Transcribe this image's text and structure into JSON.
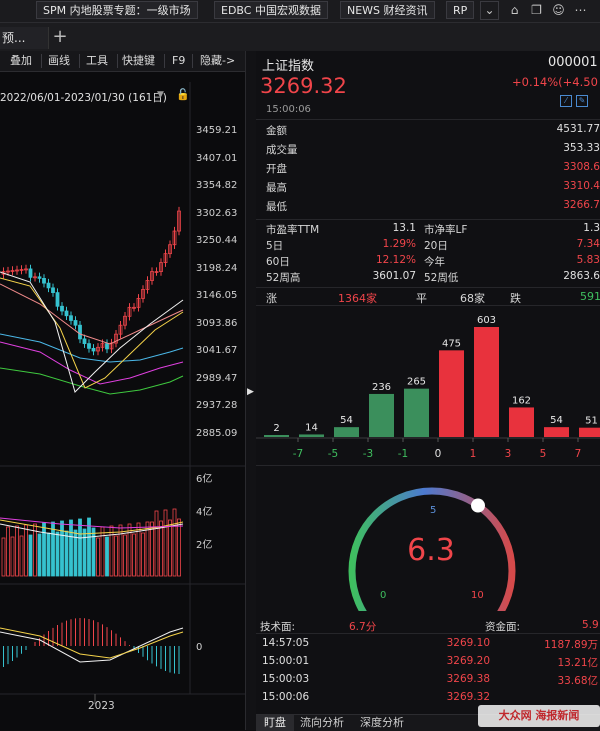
{
  "topbar": {
    "buttons": [
      "SPM 内地股票专题：一级市场",
      "EDBC 中国宏观数据",
      "NEWS 财经资讯",
      "RP"
    ]
  },
  "tabbar": {
    "tab_label": "预...",
    "add_label": "+"
  },
  "toolbar": {
    "items": [
      "叠加",
      "画线",
      "工具",
      "快捷键",
      "F9",
      "隐藏->"
    ]
  },
  "chart": {
    "date_range": "2022/06/01-2023/01/30 (161日)",
    "price_ticks": [
      "3459.21",
      "3407.01",
      "3354.82",
      "3302.63",
      "3250.44",
      "3198.24",
      "3146.05",
      "3093.86",
      "3041.67",
      "2989.47",
      "2937.28",
      "2885.09"
    ],
    "volume_ticks": [
      "6亿",
      "4亿",
      "2亿"
    ],
    "macd_tick": "0",
    "x_label": "2023",
    "colors": {
      "up": "#f0454a",
      "down": "#36c2cf",
      "ma1": "#f2f2f2",
      "ma2": "#f5d34a",
      "ma3": "#e040e0",
      "ma4": "#3fc93f",
      "ma5": "#4bb8e8",
      "ma6": "#f08a8a"
    }
  },
  "quote": {
    "name": "上证指数",
    "code": "000001",
    "price": "3269.32",
    "change": "+0.14%(+4.50",
    "time": "15:00:06"
  },
  "stats": [
    {
      "label": "金额",
      "value": "4531.77",
      "color": "neutral"
    },
    {
      "label": "成交量",
      "value": "353.33",
      "color": "neutral"
    },
    {
      "label": "开盘",
      "value": "3308.6",
      "color": "red"
    },
    {
      "label": "最高",
      "value": "3310.4",
      "color": "red"
    },
    {
      "label": "最低",
      "value": "3266.7",
      "color": "red"
    }
  ],
  "valuation": [
    {
      "l1": "市盈率TTM",
      "v1": "13.1",
      "c1": "neutral",
      "l2": "市净率LF",
      "v2": "1.3",
      "c2": "neutral"
    },
    {
      "l1": "5日",
      "v1": "1.29%",
      "c1": "red",
      "l2": "20日",
      "v2": "7.34",
      "c2": "red"
    },
    {
      "l1": "60日",
      "v1": "12.12%",
      "c1": "red",
      "l2": "今年",
      "v2": "5.83",
      "c2": "red"
    },
    {
      "l1": "52周高",
      "v1": "3601.07",
      "c1": "neutral",
      "l2": "52周低",
      "v2": "2863.6",
      "c2": "neutral"
    }
  ],
  "breadth": {
    "up_label": "涨",
    "up_count": "1364家",
    "flat_label": "平",
    "flat_count": "68家",
    "down_label": "跌",
    "down_count": "591"
  },
  "distribution": {
    "bars": [
      {
        "value": "2",
        "color": "#3b8f5c"
      },
      {
        "value": "14",
        "color": "#3b8f5c"
      },
      {
        "value": "54",
        "color": "#3b8f5c"
      },
      {
        "value": "236",
        "color": "#3b8f5c"
      },
      {
        "value": "265",
        "color": "#3b8f5c"
      },
      {
        "value": "475",
        "color": "#e8323d"
      },
      {
        "value": "603",
        "color": "#e8323d"
      },
      {
        "value": "162",
        "color": "#e8323d"
      },
      {
        "value": "54",
        "color": "#e8323d"
      },
      {
        "value": "51",
        "color": "#e8323d"
      }
    ],
    "axis_labels": [
      {
        "text": "-7",
        "color": "green"
      },
      {
        "text": "-5",
        "color": "green"
      },
      {
        "text": "-3",
        "color": "green"
      },
      {
        "text": "-1",
        "color": "green"
      },
      {
        "text": "0",
        "color": "neutral"
      },
      {
        "text": "1",
        "color": "red"
      },
      {
        "text": "3",
        "color": "red"
      },
      {
        "text": "5",
        "color": "red"
      },
      {
        "text": "7",
        "color": "red"
      }
    ]
  },
  "gauge": {
    "value": "6.3",
    "min_label": "0",
    "mid_label": "5",
    "max_label": "10",
    "level": 0.63
  },
  "technical": {
    "label": "技术面:",
    "value": "6.7分",
    "capital_label": "资金面:",
    "capital_value": "5.9"
  },
  "ticks": [
    {
      "time": "14:57:05",
      "price": "3269.10",
      "amount": "1187.89万"
    },
    {
      "time": "15:00:01",
      "price": "3269.20",
      "amount": "13.21亿"
    },
    {
      "time": "15:00:03",
      "price": "3269.38",
      "amount": "33.68亿"
    },
    {
      "time": "15:00:06",
      "price": "3269.32",
      "amount": ""
    }
  ],
  "bottom_tabs": [
    "盯盘",
    "流向分析",
    "深度分析"
  ],
  "watermark": "大众网 海报新闻"
}
